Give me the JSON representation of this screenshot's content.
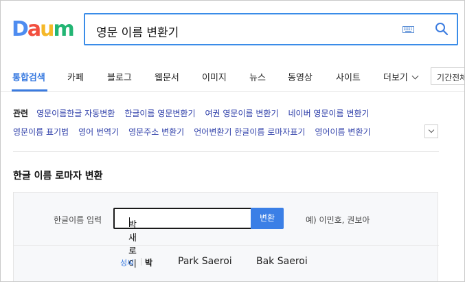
{
  "logo": {
    "letters": [
      "D",
      "a",
      "u",
      "m"
    ],
    "colors": [
      "#4e8cf0",
      "#f24f3f",
      "#f5b828",
      "#22b573"
    ]
  },
  "search": {
    "query": "영문 이름 변환기"
  },
  "tabs": {
    "items": [
      "통합검색",
      "카페",
      "블로그",
      "웹문서",
      "이미지",
      "뉴스",
      "동영상",
      "사이트",
      "더보기"
    ],
    "active_index": 0,
    "period_filter": "기간전체"
  },
  "related": {
    "title": "관련",
    "row1": [
      "영문이름한글 자동변환",
      "한글이름 영문변환기",
      "여권 영문이름 변환기",
      "네이버 영문이름 변환기"
    ],
    "row2": [
      "영문이름 표기법",
      "영어 번역기",
      "영문주소 변환기",
      "언어변환기 한글이름 로마자표기",
      "영어이름 변환기"
    ]
  },
  "converter": {
    "title": "한글 이름 로마자 변환",
    "input_label": "한글이름 입력",
    "input_value": "박새로이",
    "button_label": "변환",
    "example": "예) 이민호, 권보아",
    "result": {
      "label": "성씨",
      "korean": "박",
      "romanizations": [
        "Park Saeroi",
        "Bak Saeroi"
      ]
    }
  },
  "colors": {
    "accent": "#3a7be0",
    "link": "#2c3da8"
  }
}
